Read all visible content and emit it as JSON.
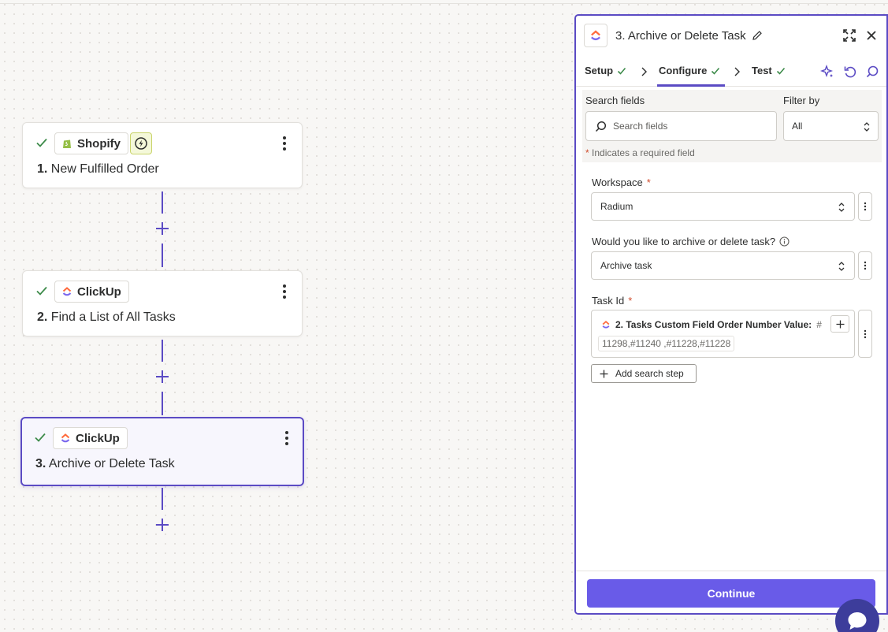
{
  "canvas": {
    "steps": [
      {
        "number": "1.",
        "name": "New Fulfilled Order",
        "app": "Shopify"
      },
      {
        "number": "2.",
        "name": "Find a List of All Tasks",
        "app": "ClickUp"
      },
      {
        "number": "3.",
        "name": "Archive or Delete Task",
        "app": "ClickUp"
      }
    ]
  },
  "panel": {
    "title": "3. Archive or Delete Task",
    "tabs": [
      {
        "label": "Setup"
      },
      {
        "label": "Configure"
      },
      {
        "label": "Test"
      }
    ],
    "search": {
      "label": "Search fields",
      "placeholder": "Search fields",
      "filter_label": "Filter by",
      "filter_value": "All",
      "required_note": "Indicates a required field",
      "required_mark": "*"
    },
    "fields": {
      "workspace": {
        "label": "Workspace",
        "required": "*",
        "value": "Radium"
      },
      "action": {
        "label": "Would you like to archive or delete task?",
        "value": "Archive task"
      },
      "task_id": {
        "label": "Task Id",
        "required": "*",
        "pill_label": "2. Tasks Custom Field Order Number Value:",
        "pill_suffix": "#",
        "value": "11298,#11240 ,#11228,#11228"
      }
    },
    "add_search_step": "Add search step",
    "continue_label": "Continue"
  },
  "colors": {
    "accent": "#5b4bc4",
    "continue": "#695be8",
    "check": "#3d8b4a",
    "required": "#d14c2d"
  }
}
